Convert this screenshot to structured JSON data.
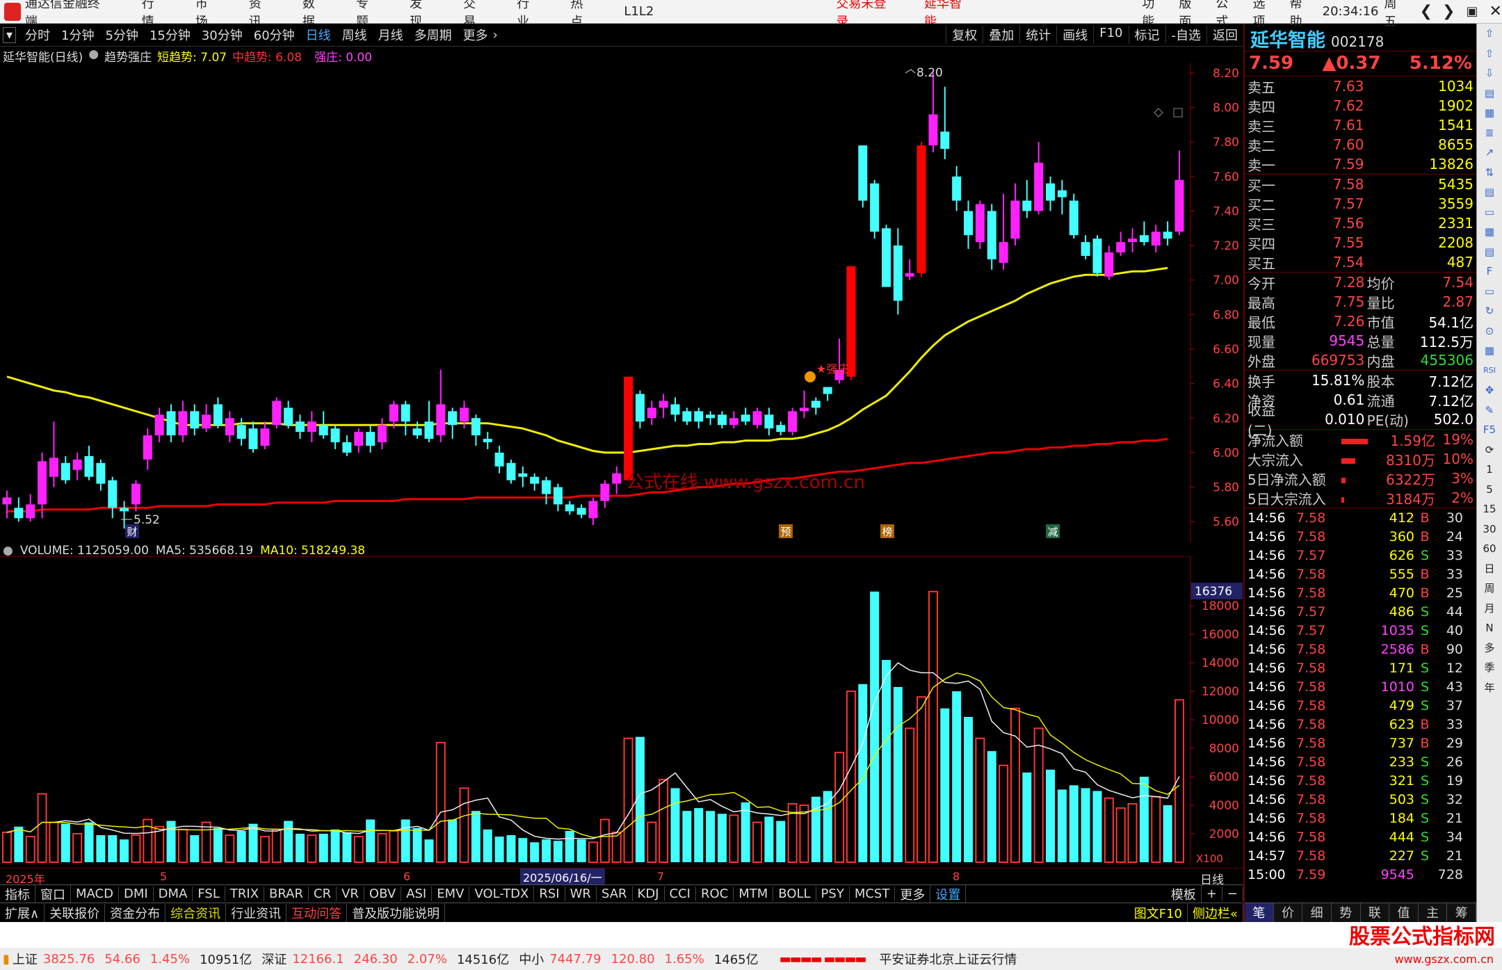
{
  "topbar": {
    "app": "通达信金融终端",
    "menu": [
      "行情",
      "市场",
      "资讯",
      "数据",
      "专题",
      "发现",
      "交易",
      "行业",
      "热点",
      "L1L2"
    ],
    "status1": "交易未登录",
    "status2": "延华智能",
    "right": [
      "功能",
      "版面",
      "公式",
      "选项",
      "帮助"
    ],
    "time": "20:34:16",
    "weekday": "周五"
  },
  "periods": [
    "分时",
    "1分钟",
    "5分钟",
    "15分钟",
    "30分钟",
    "60分钟",
    "日线",
    "周线",
    "月线",
    "多周期",
    "更多"
  ],
  "tools": [
    "复权",
    "叠加",
    "统计",
    "画线",
    "F10",
    "标记",
    "-自选",
    "返回"
  ],
  "info": {
    "name": "延华智能(日线)",
    "indicator": "趋势强庄",
    "short": "短趋势: 7.07",
    "mid": "中趋势: 6.08",
    "strong": "强庄: 0.00"
  },
  "volinfo": {
    "vol": "VOLUME: 1125059.00",
    "ma5": "MA5: 535668.19",
    "ma10": "MA10: 518249.38"
  },
  "dates": [
    "2025年",
    "5",
    "6",
    "2025/06/16/一",
    "7",
    "8",
    "日线"
  ],
  "indicators": [
    "指标",
    "窗口",
    "MACD",
    "DMI",
    "DMA",
    "FSL",
    "TRIX",
    "BRAR",
    "CR",
    "VR",
    "OBV",
    "ASI",
    "EMV",
    "VOL-TDX",
    "RSI",
    "WR",
    "SAR",
    "KDJ",
    "CCI",
    "ROC",
    "MTM",
    "BOLL",
    "PSY",
    "MCST",
    "更多",
    "设置",
    "模板"
  ],
  "bottomtabs": [
    "扩展∧",
    "关联报价",
    "资金分布",
    "综合资讯",
    "行业资讯",
    "互动问答",
    "普及版功能说明",
    "图文F10",
    "侧边栏«"
  ],
  "quote": {
    "name": "延华智能",
    "code": "002178",
    "price": "7.59",
    "change": "▲0.37",
    "pct": "5.12%",
    "asks": [
      [
        "卖五",
        "7.63",
        "1034"
      ],
      [
        "卖四",
        "7.62",
        "1902"
      ],
      [
        "卖三",
        "7.61",
        "1541"
      ],
      [
        "卖二",
        "7.60",
        "8655"
      ],
      [
        "卖一",
        "7.59",
        "13826"
      ]
    ],
    "bids": [
      [
        "买一",
        "7.58",
        "5435"
      ],
      [
        "买二",
        "7.57",
        "3559"
      ],
      [
        "买三",
        "7.56",
        "2331"
      ],
      [
        "买四",
        "7.55",
        "2208"
      ],
      [
        "买五",
        "7.54",
        "487"
      ]
    ],
    "stats": [
      [
        "今开",
        "7.28",
        "均价",
        "7.54"
      ],
      [
        "最高",
        "7.75",
        "量比",
        "2.87"
      ],
      [
        "最低",
        "7.26",
        "市值",
        "54.1亿"
      ],
      [
        "现量",
        "9545",
        "总量",
        "112.5万"
      ],
      [
        "外盘",
        "669753",
        "内盘",
        "455306"
      ]
    ],
    "stats2": [
      [
        "换手",
        "15.81%",
        "股本",
        "7.12亿"
      ],
      [
        "净资",
        "0.61",
        "流通",
        "7.12亿"
      ],
      [
        "收益(二)",
        "0.010",
        "PE(动)",
        "502.0"
      ]
    ],
    "flows": [
      [
        "净流入额",
        "1.59亿",
        "19%"
      ],
      [
        "大宗流入",
        "8310万",
        "10%"
      ],
      [
        "5日净流入额",
        "6322万",
        "3%"
      ],
      [
        "5日大宗流入",
        "3184万",
        "2%"
      ]
    ],
    "ticks": [
      [
        "14:56",
        "7.58",
        "412",
        "B",
        "30"
      ],
      [
        "14:56",
        "7.58",
        "360",
        "B",
        "24"
      ],
      [
        "14:56",
        "7.57",
        "626",
        "S",
        "33"
      ],
      [
        "14:56",
        "7.58",
        "555",
        "B",
        "33"
      ],
      [
        "14:56",
        "7.58",
        "470",
        "B",
        "25"
      ],
      [
        "14:56",
        "7.57",
        "486",
        "S",
        "44"
      ],
      [
        "14:56",
        "7.57",
        "1035",
        "S",
        "40"
      ],
      [
        "14:56",
        "7.58",
        "2586",
        "B",
        "90"
      ],
      [
        "14:56",
        "7.58",
        "171",
        "S",
        "12"
      ],
      [
        "14:56",
        "7.58",
        "1010",
        "S",
        "43"
      ],
      [
        "14:56",
        "7.58",
        "479",
        "S",
        "37"
      ],
      [
        "14:56",
        "7.58",
        "623",
        "B",
        "33"
      ],
      [
        "14:56",
        "7.58",
        "737",
        "B",
        "29"
      ],
      [
        "14:56",
        "7.58",
        "233",
        "S",
        "26"
      ],
      [
        "14:56",
        "7.58",
        "321",
        "S",
        "19"
      ],
      [
        "14:56",
        "7.58",
        "503",
        "S",
        "32"
      ],
      [
        "14:56",
        "7.58",
        "184",
        "S",
        "21"
      ],
      [
        "14:56",
        "7.58",
        "444",
        "S",
        "34"
      ],
      [
        "14:57",
        "7.58",
        "227",
        "S",
        "21"
      ],
      [
        "15:00",
        "7.59",
        "9545",
        "",
        "728"
      ]
    ],
    "panelTabs": [
      "笔",
      "价",
      "细",
      "势",
      "联",
      "值",
      "主",
      "筹"
    ]
  },
  "statusbar": {
    "sh": "上证",
    "shv": "3825.76",
    "shc": "54.66",
    "shp": "1.45%",
    "sha": "10951亿",
    "sz": "深证",
    "szv": "12166.1",
    "szc": "246.30",
    "szp": "2.07%",
    "sza": "14516亿",
    "zx": "中小",
    "zxv": "7447.79",
    "zxc": "120.80",
    "zxp": "1.65%",
    "zxa": "1465亿",
    "broker": "平安证券北京上证云行情",
    "watermark": "股票公式指标网",
    "wmurl": "www.gszx.com.cn"
  },
  "chart_labels": {
    "high": "8.20",
    "low": "5.52",
    "mark1": "财",
    "mark2": "预",
    "mark3": "榜",
    "mark4": "减",
    "strong": "强庄",
    "site": "公式在线  www.gszx.com.cn",
    "volCursor": "16376",
    "x100": "X100"
  },
  "chart_data": {
    "type": "candlestick",
    "price_ticks": [
      8.2,
      8.0,
      7.8,
      7.6,
      7.4,
      7.2,
      7.0,
      6.8,
      6.6,
      6.4,
      6.2,
      6.0,
      5.8,
      5.6
    ],
    "vol_ticks": [
      18000,
      16000,
      14000,
      12000,
      10000,
      8000,
      6000,
      4000,
      2000
    ],
    "candles": [
      [
        5.7,
        5.74,
        5.62,
        5.78
      ],
      [
        5.68,
        5.62,
        5.6,
        5.74
      ],
      [
        5.62,
        5.7,
        5.6,
        5.76
      ],
      [
        5.7,
        5.95,
        5.62,
        6.0
      ],
      [
        5.86,
        5.97,
        5.8,
        6.18
      ],
      [
        5.94,
        5.84,
        5.82,
        5.98
      ],
      [
        5.9,
        5.96,
        5.84,
        6.0
      ],
      [
        5.98,
        5.86,
        5.84,
        6.04
      ],
      [
        5.94,
        5.82,
        5.78,
        5.96
      ],
      [
        5.84,
        5.68,
        5.62,
        5.86
      ],
      [
        5.68,
        5.66,
        5.56,
        5.72
      ],
      [
        5.7,
        5.82,
        5.66,
        5.84
      ],
      [
        5.96,
        6.1,
        5.9,
        6.14
      ],
      [
        6.1,
        6.22,
        6.06,
        6.26
      ],
      [
        6.24,
        6.1,
        6.06,
        6.28
      ],
      [
        6.1,
        6.24,
        6.06,
        6.3
      ],
      [
        6.24,
        6.14,
        6.1,
        6.28
      ],
      [
        6.14,
        6.22,
        6.12,
        6.28
      ],
      [
        6.28,
        6.16,
        6.14,
        6.32
      ],
      [
        6.1,
        6.2,
        6.06,
        6.24
      ],
      [
        6.16,
        6.08,
        6.04,
        6.2
      ],
      [
        6.14,
        6.02,
        6.0,
        6.18
      ],
      [
        6.04,
        6.14,
        6.02,
        6.18
      ],
      [
        6.16,
        6.3,
        6.14,
        6.32
      ],
      [
        6.26,
        6.16,
        6.14,
        6.3
      ],
      [
        6.18,
        6.12,
        6.08,
        6.22
      ],
      [
        6.12,
        6.18,
        6.06,
        6.24
      ],
      [
        6.16,
        6.1,
        6.08,
        6.24
      ],
      [
        6.14,
        6.06,
        6.02,
        6.16
      ],
      [
        6.06,
        6.0,
        5.98,
        6.1
      ],
      [
        6.04,
        6.12,
        6.0,
        6.14
      ],
      [
        6.12,
        6.04,
        6.0,
        6.16
      ],
      [
        6.06,
        6.16,
        6.02,
        6.2
      ],
      [
        6.18,
        6.28,
        6.14,
        6.3
      ],
      [
        6.28,
        6.18,
        6.1,
        6.3
      ],
      [
        6.14,
        6.1,
        6.08,
        6.18
      ],
      [
        6.18,
        6.08,
        6.06,
        6.3
      ],
      [
        6.1,
        6.28,
        6.06,
        6.48
      ],
      [
        6.24,
        6.16,
        6.08,
        6.26
      ],
      [
        6.18,
        6.26,
        6.14,
        6.3
      ],
      [
        6.2,
        6.1,
        6.04,
        6.22
      ],
      [
        6.08,
        6.06,
        6.02,
        6.12
      ],
      [
        6.0,
        5.92,
        5.88,
        6.04
      ],
      [
        5.94,
        5.84,
        5.82,
        5.96
      ],
      [
        5.88,
        5.86,
        5.8,
        5.92
      ],
      [
        5.86,
        5.82,
        5.78,
        5.88
      ],
      [
        5.84,
        5.76,
        5.7,
        5.86
      ],
      [
        5.8,
        5.7,
        5.66,
        5.82
      ],
      [
        5.7,
        5.66,
        5.64,
        5.72
      ],
      [
        5.68,
        5.64,
        5.62,
        5.7
      ],
      [
        5.62,
        5.72,
        5.58,
        5.74
      ],
      [
        5.72,
        5.82,
        5.68,
        5.84
      ],
      [
        5.82,
        5.88,
        5.76,
        5.92
      ],
      [
        5.84,
        6.44,
        5.84,
        6.44
      ],
      [
        6.34,
        6.18,
        6.14,
        6.36
      ],
      [
        6.2,
        6.26,
        6.16,
        6.3
      ],
      [
        6.26,
        6.3,
        6.2,
        6.34
      ],
      [
        6.28,
        6.22,
        6.18,
        6.32
      ],
      [
        6.24,
        6.18,
        6.16,
        6.26
      ],
      [
        6.24,
        6.18,
        6.14,
        6.26
      ],
      [
        6.22,
        6.2,
        6.16,
        6.24
      ],
      [
        6.22,
        6.16,
        6.14,
        6.24
      ],
      [
        6.16,
        6.2,
        6.14,
        6.24
      ],
      [
        6.22,
        6.18,
        6.16,
        6.26
      ],
      [
        6.16,
        6.24,
        6.14,
        6.26
      ],
      [
        6.22,
        6.14,
        6.1,
        6.26
      ],
      [
        6.16,
        6.12,
        6.1,
        6.18
      ],
      [
        6.12,
        6.24,
        6.1,
        6.26
      ],
      [
        6.24,
        6.26,
        6.2,
        6.36
      ],
      [
        6.3,
        6.26,
        6.22,
        6.32
      ],
      [
        6.38,
        6.34,
        6.3,
        6.38
      ],
      [
        6.42,
        6.48,
        6.4,
        6.66
      ],
      [
        6.44,
        7.08,
        6.42,
        7.08
      ],
      [
        7.78,
        7.46,
        7.42,
        7.78
      ],
      [
        7.56,
        7.28,
        7.24,
        7.58
      ],
      [
        7.3,
        6.96,
        6.96,
        7.32
      ],
      [
        7.2,
        6.88,
        6.8,
        7.3
      ],
      [
        7.02,
        7.04,
        7.0,
        7.12
      ],
      [
        7.04,
        7.78,
        7.02,
        7.8
      ],
      [
        7.78,
        7.96,
        7.74,
        8.2
      ],
      [
        7.86,
        7.76,
        7.7,
        8.12
      ],
      [
        7.6,
        7.46,
        7.4,
        7.66
      ],
      [
        7.4,
        7.26,
        7.18,
        7.46
      ],
      [
        7.22,
        7.44,
        7.18,
        7.46
      ],
      [
        7.4,
        7.12,
        7.06,
        7.44
      ],
      [
        7.1,
        7.22,
        7.06,
        7.5
      ],
      [
        7.24,
        7.46,
        7.2,
        7.56
      ],
      [
        7.46,
        7.4,
        7.36,
        7.58
      ],
      [
        7.4,
        7.68,
        7.38,
        7.8
      ],
      [
        7.56,
        7.46,
        7.4,
        7.6
      ],
      [
        7.52,
        7.48,
        7.38,
        7.58
      ],
      [
        7.46,
        7.26,
        7.24,
        7.5
      ],
      [
        7.22,
        7.14,
        7.12,
        7.26
      ],
      [
        7.24,
        7.04,
        7.02,
        7.26
      ],
      [
        7.02,
        7.16,
        7.0,
        7.2
      ],
      [
        7.16,
        7.22,
        7.14,
        7.28
      ],
      [
        7.22,
        7.24,
        7.16,
        7.3
      ],
      [
        7.26,
        7.22,
        7.2,
        7.34
      ],
      [
        7.2,
        7.28,
        7.16,
        7.32
      ],
      [
        7.28,
        7.24,
        7.2,
        7.34
      ],
      [
        7.28,
        7.58,
        7.26,
        7.75
      ]
    ],
    "volumes": [
      2100,
      2500,
      1800,
      4800,
      2800,
      2700,
      2000,
      2800,
      1900,
      1900,
      1600,
      1900,
      3000,
      2500,
      2900,
      2300,
      1900,
      2800,
      2400,
      1900,
      2200,
      2700,
      1800,
      2300,
      2900,
      2000,
      1900,
      2000,
      2300,
      2100,
      1800,
      3000,
      2000,
      2200,
      3000,
      2400,
      1600,
      8400,
      3000,
      5200,
      3600,
      2300,
      1800,
      1900,
      1700,
      1400,
      1600,
      1500,
      2200,
      1600,
      1400,
      3000,
      2100,
      8700,
      8800,
      2800,
      5800,
      5200,
      3600,
      3800,
      3600,
      3400,
      3300,
      4200,
      2800,
      3200,
      2900,
      4100,
      4000,
      4600,
      5000,
      7700,
      12000,
      12500,
      19000,
      14200,
      12300,
      9400,
      11600,
      19000,
      10800,
      12000,
      10200,
      8700,
      7800,
      6800,
      10800,
      6300,
      9400,
      6500,
      5100,
      5400,
      5200,
      5000,
      4500,
      3800,
      4100,
      6000,
      4600,
      4000,
      11400
    ],
    "ma_short": [
      6.44,
      6.42,
      6.4,
      6.38,
      6.36,
      6.35,
      6.33,
      6.32,
      6.3,
      6.28,
      6.26,
      6.24,
      6.22,
      6.2,
      6.18,
      6.16,
      6.16,
      6.16,
      6.16,
      6.16,
      6.17,
      6.17,
      6.17,
      6.17,
      6.16,
      6.16,
      6.16,
      6.16,
      6.16,
      6.16,
      6.16,
      6.16,
      6.16,
      6.16,
      6.16,
      6.16,
      6.16,
      6.17,
      6.17,
      6.17,
      6.17,
      6.17,
      6.16,
      6.15,
      6.14,
      6.12,
      6.1,
      6.07,
      6.05,
      6.03,
      6.01,
      6.0,
      6.0,
      6.0,
      6.01,
      6.02,
      6.03,
      6.04,
      6.04,
      6.05,
      6.05,
      6.06,
      6.06,
      6.07,
      6.07,
      6.07,
      6.08,
      6.08,
      6.09,
      6.11,
      6.13,
      6.16,
      6.2,
      6.25,
      6.29,
      6.33,
      6.4,
      6.47,
      6.55,
      6.62,
      6.68,
      6.72,
      6.76,
      6.79,
      6.82,
      6.85,
      6.88,
      6.92,
      6.95,
      6.98,
      7.0,
      7.02,
      7.03,
      7.03,
      7.03,
      7.04,
      7.05,
      7.05,
      7.06,
      7.07
    ],
    "ma_long": [
      5.66,
      5.66,
      5.66,
      5.67,
      5.67,
      5.67,
      5.67,
      5.67,
      5.68,
      5.68,
      5.68,
      5.68,
      5.68,
      5.69,
      5.69,
      5.69,
      5.69,
      5.69,
      5.7,
      5.7,
      5.7,
      5.7,
      5.7,
      5.71,
      5.71,
      5.71,
      5.71,
      5.71,
      5.72,
      5.72,
      5.72,
      5.72,
      5.72,
      5.72,
      5.73,
      5.73,
      5.73,
      5.73,
      5.73,
      5.73,
      5.74,
      5.74,
      5.74,
      5.74,
      5.74,
      5.74,
      5.74,
      5.74,
      5.74,
      5.75,
      5.75,
      5.75,
      5.75,
      5.75,
      5.76,
      5.77,
      5.77,
      5.78,
      5.79,
      5.8,
      5.8,
      5.81,
      5.82,
      5.82,
      5.83,
      5.84,
      5.85,
      5.85,
      5.86,
      5.87,
      5.88,
      5.89,
      5.89,
      5.9,
      5.91,
      5.92,
      5.93,
      5.94,
      5.94,
      5.95,
      5.96,
      5.97,
      5.98,
      5.99,
      6.0,
      6.0,
      6.01,
      6.02,
      6.02,
      6.03,
      6.03,
      6.04,
      6.04,
      6.05,
      6.05,
      6.06,
      6.06,
      6.07,
      6.07,
      6.08
    ]
  }
}
